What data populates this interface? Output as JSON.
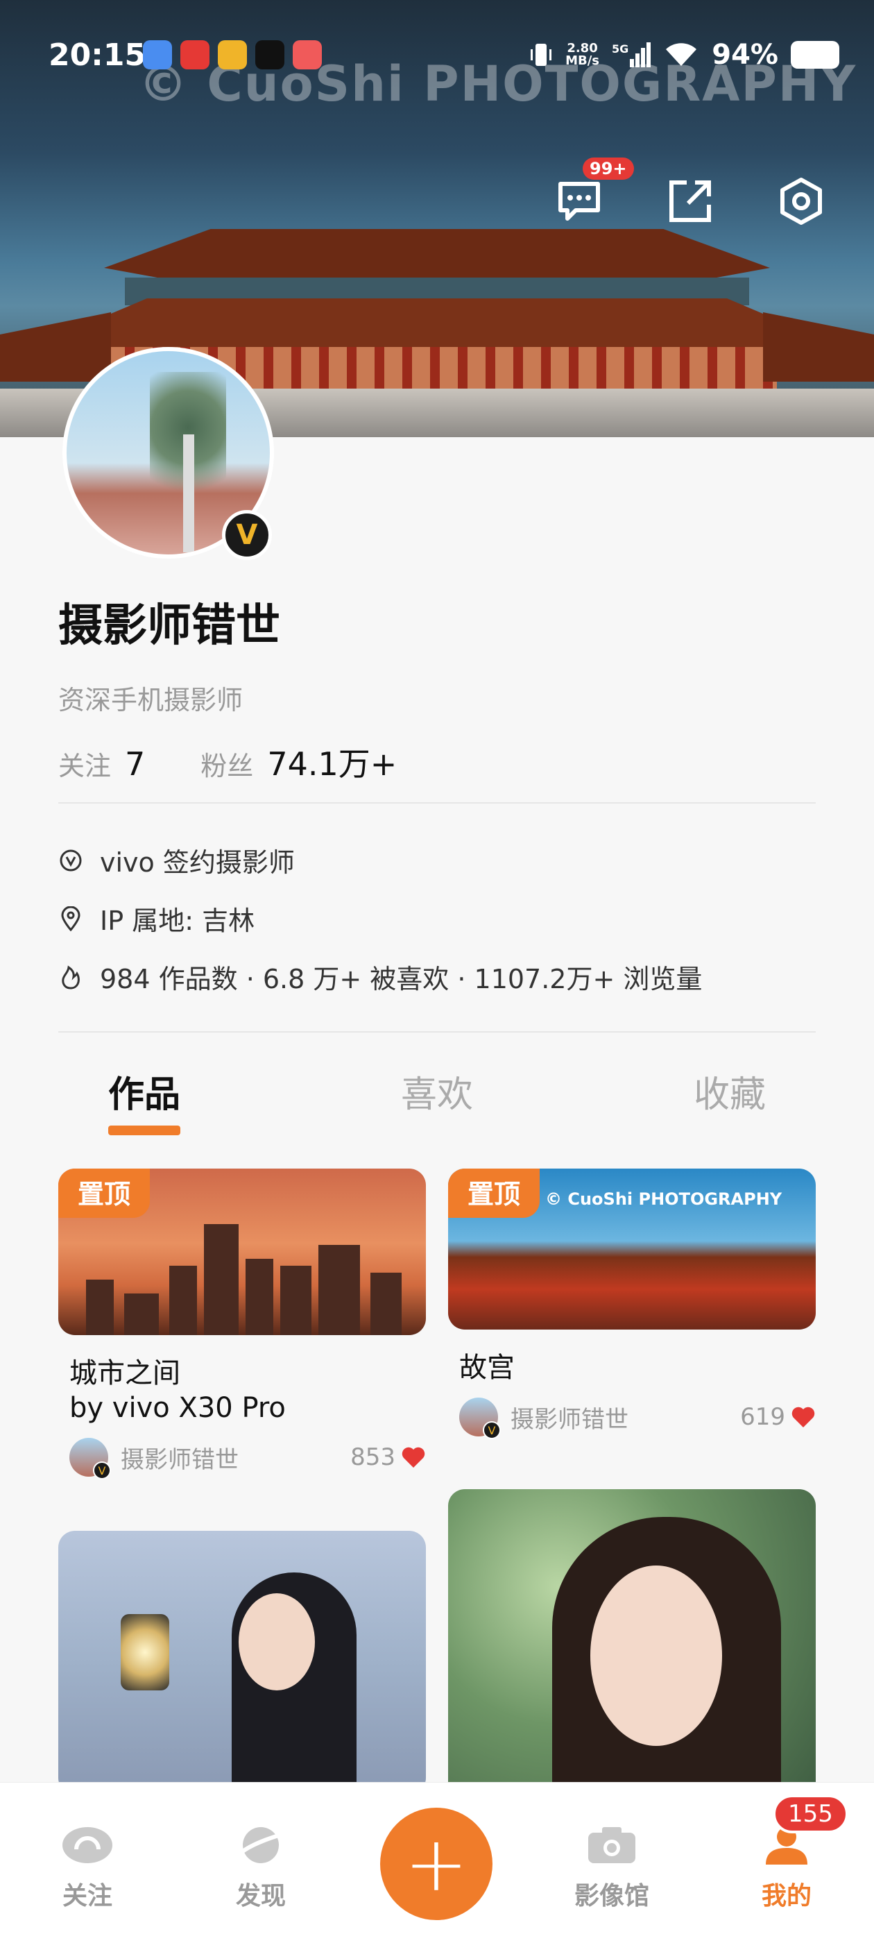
{
  "status_bar": {
    "time": "20:15",
    "net_speed": "2.80\nMB/s",
    "signal_label": "5G",
    "battery": "94%"
  },
  "banner": {
    "watermark": "© CuoShi PHOTOGRAPHY"
  },
  "header_icons": {
    "messages_badge": "99+"
  },
  "profile": {
    "name": "摄影师错世",
    "title": "资深手机摄影师",
    "following_label": "关注",
    "following_count": "7",
    "followers_label": "粉丝",
    "followers_count": "74.1万+",
    "verified_text": "vivo 签约摄影师",
    "ip_location": "IP 属地: 吉林",
    "summary": "984 作品数 · 6.8 万+ 被喜欢 · 1107.2万+ 浏览量"
  },
  "tabs": [
    {
      "label": "作品"
    },
    {
      "label": "喜欢"
    },
    {
      "label": "收藏"
    }
  ],
  "posts": [
    {
      "pin": "置顶",
      "title_line1": "城市之间",
      "title_line2": "by vivo X30 Pro",
      "author": "摄影师错世",
      "likes": "853"
    },
    {
      "pin": "置顶",
      "watermark": "© CuoShi PHOTOGRAPHY",
      "title_line1": "故宫",
      "author": "摄影师错世",
      "likes": "619"
    }
  ],
  "bottom_nav": {
    "items": [
      {
        "label": "关注"
      },
      {
        "label": "发现"
      },
      {
        "label": "影像馆"
      },
      {
        "label": "我的"
      }
    ],
    "plus": "+",
    "badge": "155"
  },
  "colors": {
    "accent": "#f07c2a",
    "badge_red": "#e53935",
    "heart": "#e53935"
  }
}
